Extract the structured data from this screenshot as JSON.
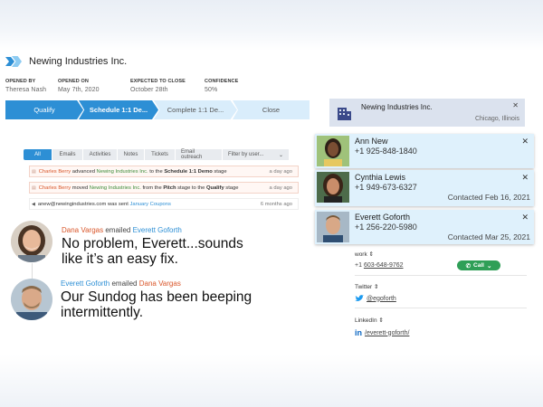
{
  "header": {
    "company_name": "Newing Industries Inc."
  },
  "meta": [
    {
      "label": "OPENED BY",
      "value": "Theresa Nash"
    },
    {
      "label": "OPENED ON",
      "value": "May 7th, 2020"
    },
    {
      "label": "EXPECTED TO CLOSE",
      "value": "October 28th"
    },
    {
      "label": "CONFIDENCE",
      "value": "50%"
    }
  ],
  "stages": [
    "Qualify",
    "Schedule 1:1 De...",
    "Complete 1:1 De...",
    "Close"
  ],
  "filters": {
    "tabs": [
      "All",
      "Emails",
      "Activities",
      "Notes",
      "Tickets",
      "Email outreach"
    ],
    "select": "Filter by user..."
  },
  "feed": [
    {
      "actor": "Charles Berry",
      "verb": " advanced ",
      "target": "Newing Industries Inc.",
      "mid": " to the ",
      "stage": "Schedule 1:1 Demo",
      "end": " stage",
      "time": "a day ago"
    },
    {
      "actor": "Charles Berry",
      "verb": " moved ",
      "target": "Newing Industries Inc.",
      "mid": " from the ",
      "stage": "Pitch",
      "mid2": " stage to the ",
      "stage2": "Qualify",
      "end": " stage",
      "time": "a day ago"
    },
    {
      "email": "anew@newingindustries.com",
      "verb": " was sent ",
      "target": "January Coupons",
      "time": "6 months ago"
    }
  ],
  "conversation": [
    {
      "sender": "Dana Vargas",
      "action": " emailed ",
      "recipient": "Everett Goforth",
      "message_l1": "No problem, Everett...sounds",
      "message_l2": "like it’s an easy fix."
    },
    {
      "sender": "Everett Goforth",
      "action": " emailed ",
      "recipient": "Dana Vargas",
      "message_l1": "Our Sundog has been beeping",
      "message_l2": "intermittently."
    }
  ],
  "company_card": {
    "name": "Newing Industries Inc.",
    "location": "Chicago, Illinois"
  },
  "contacts": [
    {
      "name": "Ann New",
      "phone": "+1 925-848-1840",
      "contacted": ""
    },
    {
      "name": "Cynthia Lewis",
      "phone": "+1 949-673-6327",
      "contacted": "Contacted Feb 16, 2021"
    },
    {
      "name": "Everett Goforth",
      "phone": "+1 256-220-5980",
      "contacted": "Contacted Mar 25, 2021"
    }
  ],
  "details": {
    "work_label": "work",
    "work_phone_prefix": "+1 ",
    "work_phone": "603-648-9762",
    "call_label": "Call",
    "twitter_label": "Twitter",
    "twitter_handle": "@egoforth",
    "linkedin_label": "LinkedIn",
    "linkedin_handle": "/everett-goforth/"
  },
  "colors": {
    "accent": "#2d8fd5",
    "call_green": "#2f9f57",
    "contact_bg": "#dff1fc"
  }
}
